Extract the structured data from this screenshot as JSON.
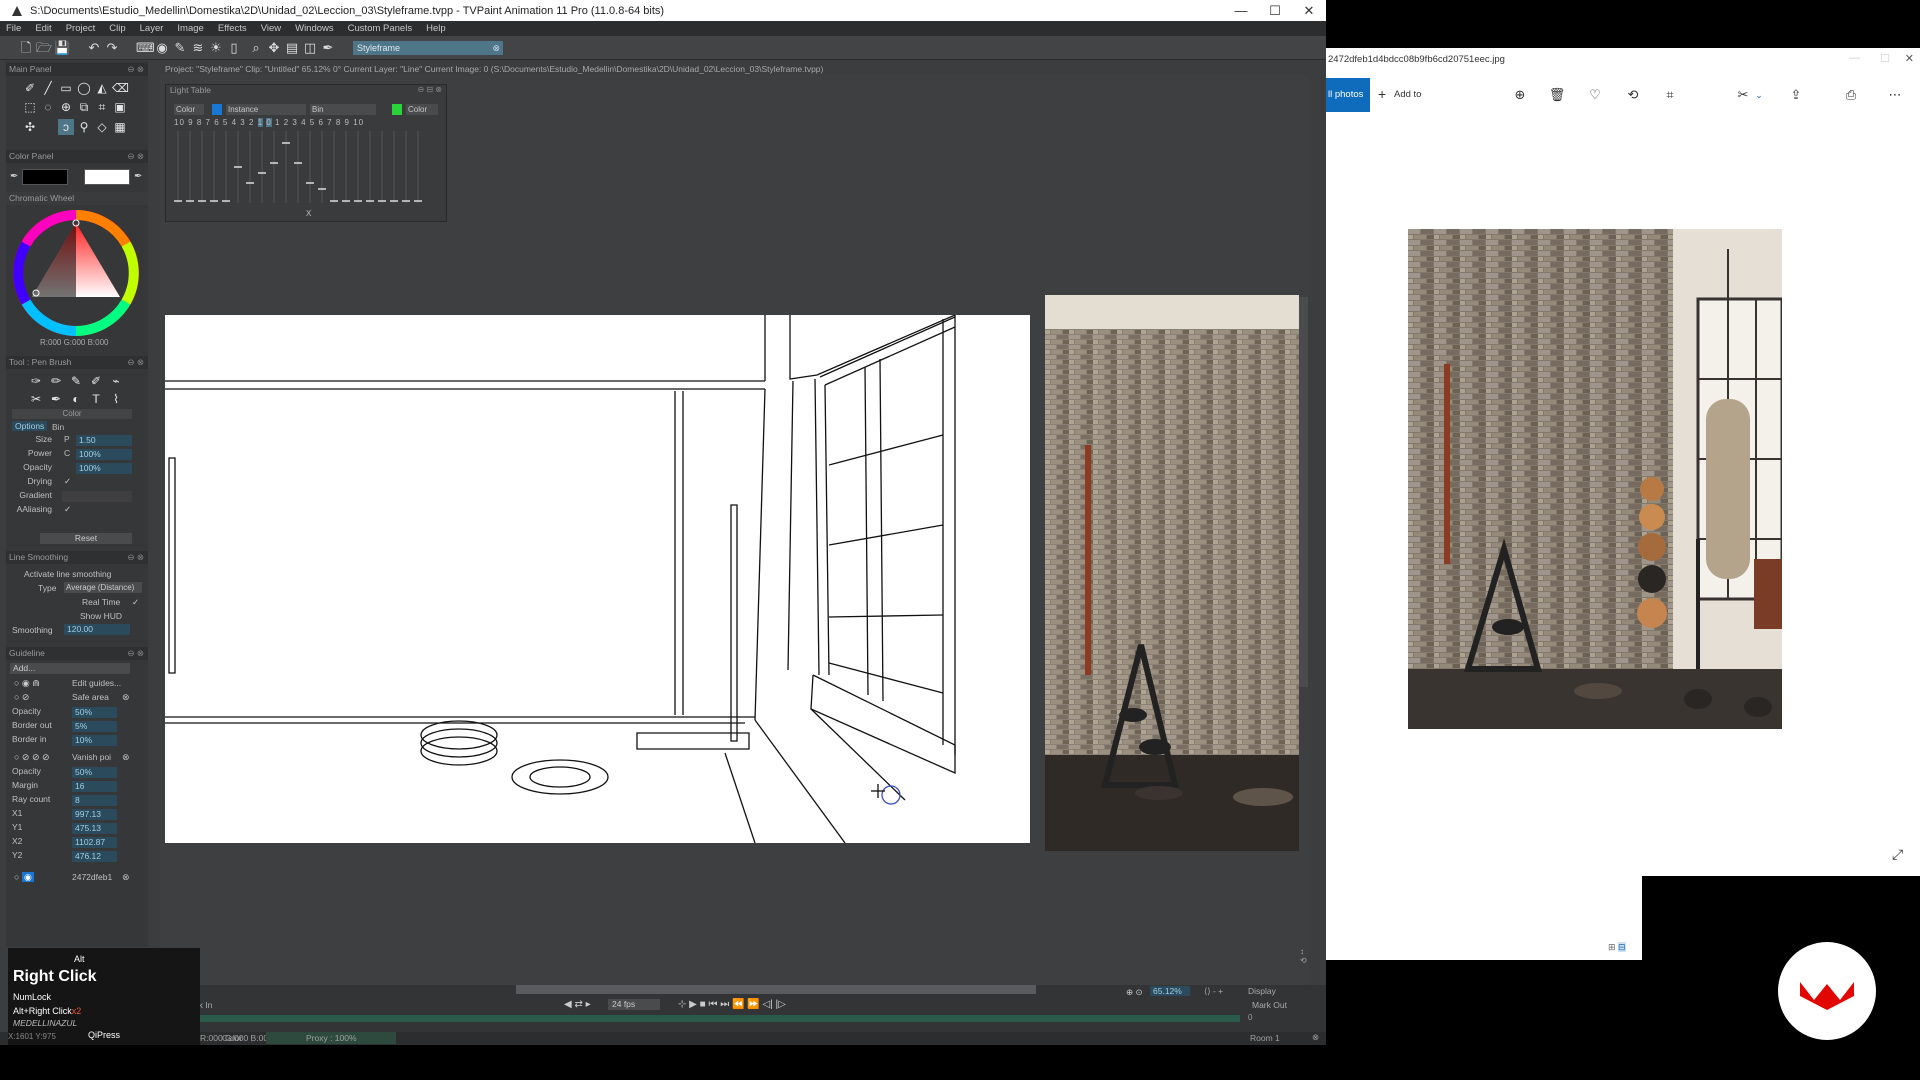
{
  "tvpaint": {
    "window_title": "S:\\Documents\\Estudio_Medellin\\Domestika\\2D\\Unidad_02\\Leccion_03\\Styleframe.tvpp - TVPaint Animation 11 Pro (11.0.8-64 bits)",
    "menu": [
      "File",
      "Edit",
      "Project",
      "Clip",
      "Layer",
      "Image",
      "Effects",
      "View",
      "Windows",
      "Custom Panels",
      "Help"
    ],
    "toolbar_chip": "Styleframe",
    "project_info": "Project: \"Styleframe\"  Clip: \"Untitled\"  65.12%  0°  Current Layer: \"Line\"  Current Image: 0 (S:\\Documents\\Estudio_Medellin\\Domestika\\2D\\Unidad_02\\Leccion_03\\Styleframe.tvpp)",
    "main_panel": {
      "title": "Main Panel"
    },
    "color_panel": {
      "title": "Color Panel",
      "chromatic_title": "Chromatic Wheel",
      "rgb_readout": "R:000 G:000 B:000"
    },
    "tool_panel": {
      "title": "Tool : Pen Brush",
      "color_tab": "Color",
      "tabs": [
        "Options",
        "Bin"
      ],
      "props": [
        {
          "label": "Size",
          "short": "P",
          "value": "1.50"
        },
        {
          "label": "Power",
          "short": "C",
          "value": "100%"
        },
        {
          "label": "Opacity",
          "short": "",
          "value": "100%"
        }
      ],
      "checks": [
        {
          "label": "Drying",
          "mark": "✓"
        },
        {
          "label": "Gradient",
          "mark": ""
        },
        {
          "label": "AAliasing",
          "mark": "✓"
        }
      ],
      "reset_label": "Reset"
    },
    "line_smoothing": {
      "title": "Line Smoothing",
      "activate": "Activate line smoothing",
      "type_label": "Type",
      "type_value": "Average (Distance)",
      "realtime": "Real Time",
      "showhud": "Show HUD",
      "smoothing_label": "Smoothing",
      "smoothing_value": "120.00"
    },
    "guideline": {
      "title": "Guideline",
      "add_label": "Add...",
      "edit_guides": "Edit guides...",
      "safe_area": "Safe area",
      "safe_rows": [
        {
          "label": "Opacity",
          "value": "50%"
        },
        {
          "label": "Border out",
          "value": "5%"
        },
        {
          "label": "Border in",
          "value": "10%"
        }
      ],
      "vanish": "Vanish poi",
      "vanish_rows": [
        {
          "label": "Opacity",
          "value": "50%"
        },
        {
          "label": "Margin",
          "value": "16"
        },
        {
          "label": "Ray count",
          "value": "8"
        },
        {
          "label": "X1",
          "value": "997.13"
        },
        {
          "label": "Y1",
          "value": "475.13"
        },
        {
          "label": "X2",
          "value": "1102.87"
        },
        {
          "label": "Y2",
          "value": "476.12"
        }
      ],
      "image_guide": "2472dfeb1"
    },
    "light_table": {
      "title": "Light Table",
      "col_headers": [
        "Color",
        "Instance",
        "Bin",
        "Color"
      ],
      "left_numbers": [
        "10",
        "9",
        "8",
        "7",
        "6",
        "5",
        "4",
        "3",
        "2",
        "1",
        "0"
      ],
      "right_numbers": [
        "1",
        "2",
        "3",
        "4",
        "5",
        "6",
        "7",
        "8",
        "9",
        "10"
      ],
      "x_label": "X"
    },
    "timeline": {
      "mark_in": "Mark In",
      "fps": "24 fps",
      "zoom": "65.12%",
      "display": "Display",
      "mark_out": "Mark Out",
      "frame_left": "0",
      "frame_right": "0"
    },
    "status": {
      "coords": "X:1601  Y:975",
      "rgba": "R:000 G:000 B:000 A:000",
      "color": "Color",
      "proxy": "Proxy : 100%",
      "room": "Room 1"
    }
  },
  "key_overlay": {
    "top": "Alt",
    "main": "Right Click",
    "line1": "NumLock",
    "line2": "Alt+Right Click",
    "line2_count": "x2",
    "line3": "MEDELLINAZUL",
    "qipress": "QiPress"
  },
  "photos": {
    "title": "2472dfeb1d4bdcc08b9fb6cd20751eec.jpg",
    "all_photos": "ll photos",
    "add_to": "Add to"
  },
  "colors": {
    "accent_blue": "#0f6cbd",
    "tvp_bg": "#3c3d3f",
    "field_bg": "#2b4a5c",
    "brand_red": "#e10600"
  }
}
